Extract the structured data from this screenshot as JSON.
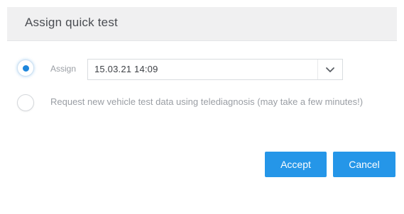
{
  "dialog": {
    "title": "Assign quick test"
  },
  "options": {
    "assign": {
      "label": "Assign",
      "selected": true,
      "select_value": "15.03.21 14:09"
    },
    "request": {
      "label": "Request new vehicle test data using telediagnosis (may take a few minutes!)",
      "selected": false
    }
  },
  "buttons": {
    "accept_label": "Accept",
    "cancel_label": "Cancel"
  },
  "colors": {
    "accent": "#2596e8",
    "radio_dot": "#1d86dc",
    "header_bg": "#f0f0f1",
    "muted_text": "#9a9ea4"
  },
  "icons": {
    "dropdown": "chevron-down-icon"
  }
}
